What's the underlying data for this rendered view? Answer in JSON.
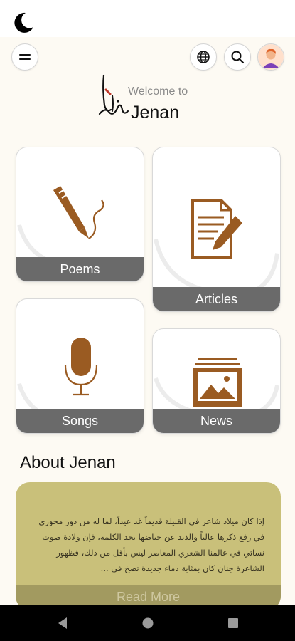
{
  "header": {
    "welcome": "Welcome to",
    "brand": "Jenan"
  },
  "cards": [
    {
      "label": "Poems",
      "icon": "quill-pen-icon"
    },
    {
      "label": "Articles",
      "icon": "document-edit-icon"
    },
    {
      "label": "Songs",
      "icon": "microphone-icon"
    },
    {
      "label": "News",
      "icon": "image-archive-icon"
    }
  ],
  "about": {
    "title": "About Jenan",
    "text": "إذا كان ميلاد شاعر في القبيلة قديماً غد عيداً، لما له من دور محوري في رفع ذكرها عالياً والذيد عن حياضها بحد الكلمة، فإن ولادة صوت نسائي في عالمنا الشعري المعاصر ليس بأقل من ذلك، فظهور الشاعرة جنان كان بمثابة دماء جديدة تضخ في ...",
    "read_more": "Read More"
  },
  "colors": {
    "accent_brown": "#9a5b22",
    "card_label_bg": "#6a6a6a",
    "about_bg": "#c9c07a",
    "page_bg": "#fdfaf3"
  },
  "icons": {
    "theme": "moon-icon",
    "menu": "menu-icon",
    "language": "globe-icon",
    "search": "search-icon",
    "profile": "avatar"
  }
}
